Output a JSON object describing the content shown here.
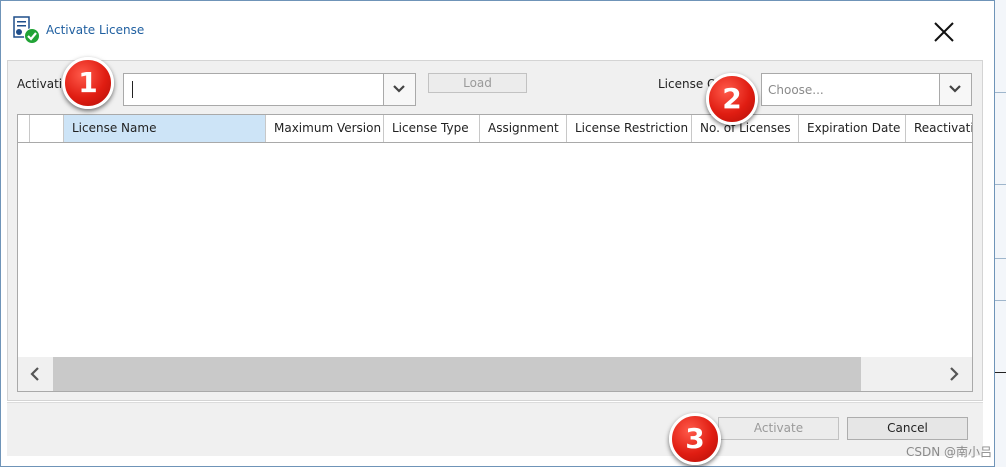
{
  "dialog": {
    "title": "Activate License",
    "close_icon": "close-icon"
  },
  "form": {
    "activation_label": "Activatio",
    "activation_value": "",
    "load_label": "Load",
    "license_label": "License Q",
    "license_placeholder": "Choose..."
  },
  "table": {
    "columns": [
      "",
      "License Name",
      "Maximum Version",
      "License Type",
      "Assignment",
      "License Restriction",
      "No. of Licenses",
      "Expiration Date",
      "Reactivatio"
    ],
    "selected_column": "License Name",
    "rows": []
  },
  "footer": {
    "activate_label": "Activate",
    "cancel_label": "Cancel"
  },
  "annotations": [
    "1",
    "2",
    "3"
  ],
  "watermark": "CSDN @南小吕",
  "colors": {
    "title": "#1f5fa0",
    "selected_header": "#cde4f7",
    "badge": "#e01d12"
  }
}
